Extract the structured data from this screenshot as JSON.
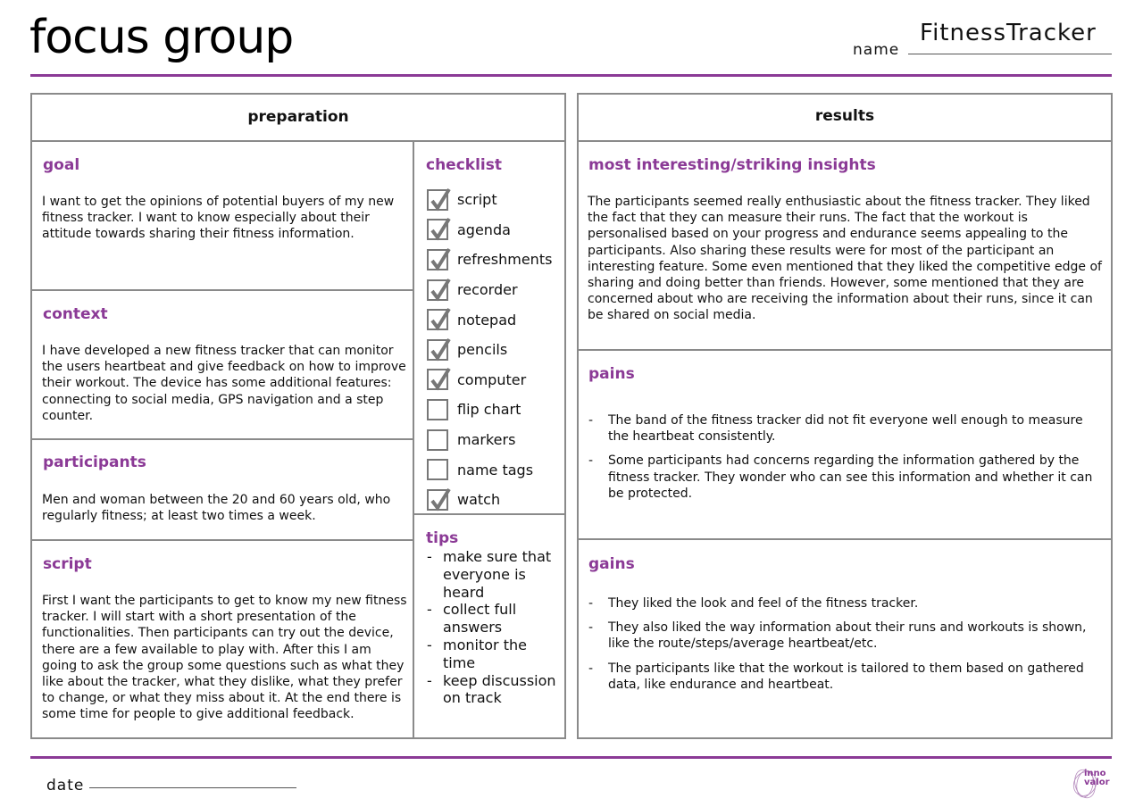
{
  "header": {
    "title": "focus group",
    "name_label": "name",
    "name_value": "FitnessTracker"
  },
  "preparation": {
    "title": "preparation",
    "goal": {
      "title": "goal",
      "text": "I want to get the opinions of potential buyers of my new fitness tracker. I want to know especially about their attitude towards sharing their fitness information."
    },
    "context": {
      "title": "context",
      "text": "I have developed a new fitness tracker that can monitor the users heartbeat and give feedback on how to improve their workout. The device has some additional features: connecting to social media, GPS navigation and a step counter."
    },
    "participants": {
      "title": "participants",
      "text": "Men and woman between the 20 and 60 years old, who regularly fitness; at least two times a week."
    },
    "script": {
      "title": "script",
      "text": "First I want the participants to get to know my new fitness tracker. I will start with a short presentation of the functionalities. Then participants can try out the device, there are a few available to play with. After this I am going to ask the group some questions such as what they like about the tracker, what they dislike, what they prefer to change, or what they miss about it. At the end there is some time for people to give additional feedback."
    },
    "checklist": {
      "title": "checklist",
      "items": [
        {
          "label": "script",
          "checked": true
        },
        {
          "label": "agenda",
          "checked": true
        },
        {
          "label": "refreshments",
          "checked": true
        },
        {
          "label": "recorder",
          "checked": true
        },
        {
          "label": "notepad",
          "checked": true
        },
        {
          "label": "pencils",
          "checked": true
        },
        {
          "label": "computer",
          "checked": true
        },
        {
          "label": "flip chart",
          "checked": false
        },
        {
          "label": "markers",
          "checked": false
        },
        {
          "label": "name tags",
          "checked": false
        },
        {
          "label": "watch",
          "checked": true
        }
      ]
    },
    "tips": {
      "title": "tips",
      "bullet": "-",
      "items": [
        "make sure that everyone is heard",
        "collect full answers",
        "monitor the time",
        "keep discussion on track"
      ]
    }
  },
  "results": {
    "title": "results",
    "insights": {
      "title": "most interesting/striking insights",
      "text": "The participants seemed really enthusiastic about the fitness tracker. They liked the fact that they can measure their runs. The fact that the workout is personalised based on your progress and endurance seems appealing to the participants. Also sharing these results were for most of the participant an interesting feature. Some even mentioned that they liked the competitive edge of sharing and doing better than friends. However, some mentioned that they are concerned about who are receiving the information about their runs, since it can be shared on social media."
    },
    "pains": {
      "title": "pains",
      "bullet": "-",
      "items": [
        "The band of the fitness tracker did not fit everyone well enough to measure the heartbeat consistently.",
        "Some participants had concerns regarding the information gathered by the fitness tracker. They wonder who can see this information and whether it can be protected."
      ]
    },
    "gains": {
      "title": "gains",
      "bullet": "-",
      "items": [
        "They liked the look and feel of the fitness tracker.",
        "They also liked the way information about their runs and workouts is shown, like the route/steps/average heartbeat/etc.",
        "The participants like that the workout is tailored to them based on gathered data, like endurance and heartbeat."
      ]
    }
  },
  "footer": {
    "date_label": "date",
    "logo_line1": "inno",
    "logo_line2": "valor"
  },
  "colors": {
    "accent": "#8b3a96",
    "border": "#8a8a8a",
    "text": "#111111"
  }
}
